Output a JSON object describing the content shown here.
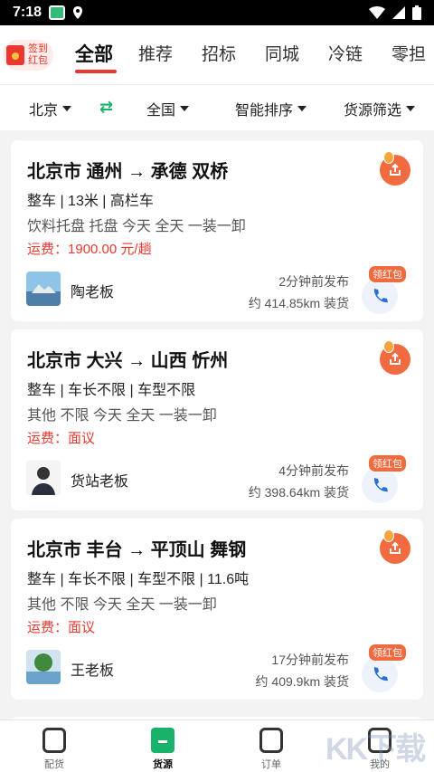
{
  "status_bar": {
    "time": "7:18"
  },
  "top_tabs": {
    "signin_label": "签到红包",
    "tabs": [
      "全部",
      "推荐",
      "招标",
      "同城",
      "冷链",
      "零担"
    ],
    "active_index": 0
  },
  "filters": {
    "origin": "北京",
    "destination": "全国",
    "sort": "智能排序",
    "cargo_filter": "货源筛选"
  },
  "cards": [
    {
      "route": "北京市 通州 → 承德 双桥",
      "spec": "整车 | 13米 | 高栏车",
      "goods": "饮料托盘 托盘 今天 全天 一装一卸",
      "fee_label": "运费：",
      "fee_value": "1900.00 元/趟",
      "owner": "陶老板",
      "posted": "2分钟前发布",
      "distance": "约 414.85km 装货",
      "badge": "领红包"
    },
    {
      "route": "北京市 大兴 → 山西 忻州",
      "spec": "整车 | 车长不限 | 车型不限",
      "goods": "其他 不限 今天 全天 一装一卸",
      "fee_label": "运费：",
      "fee_value": "面议",
      "owner": "货站老板",
      "posted": "4分钟前发布",
      "distance": "约 398.64km 装货",
      "badge": "领红包"
    },
    {
      "route": "北京市 丰台 → 平顶山 舞钢",
      "spec": "整车 | 车长不限 | 车型不限 | 11.6吨",
      "goods": "其他 不限 今天 全天 一装一卸",
      "fee_label": "运费：",
      "fee_value": "面议",
      "owner": "王老板",
      "posted": "17分钟前发布",
      "distance": "约 409.9km 装货",
      "badge": "领红包"
    }
  ],
  "bottom_nav": {
    "items": [
      "配货",
      "货源",
      "订单",
      "我的"
    ],
    "active_index": 1
  },
  "watermark": "KK下载",
  "colors": {
    "accent_red": "#e8382f",
    "accent_green": "#18b26b",
    "orange": "#f26a3f"
  }
}
